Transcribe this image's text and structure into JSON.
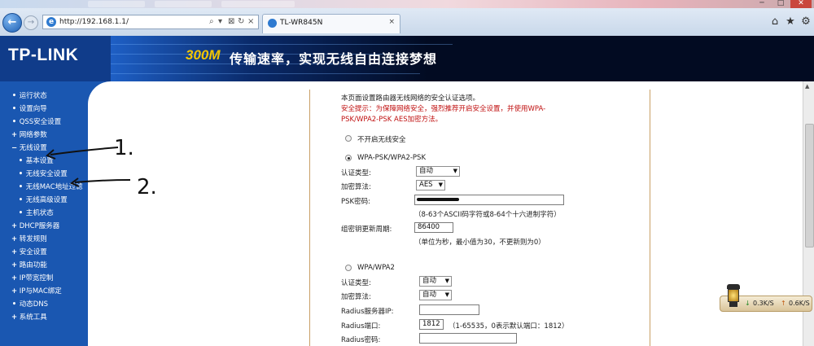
{
  "browser": {
    "address": "http://192.168.1.1/",
    "tab_title": "TL-WR845N",
    "tab_close": "×",
    "nav_back": "←",
    "nav_forward": "→",
    "address_tools": [
      "⌕",
      "▾",
      "⊠",
      "↻",
      "×"
    ],
    "window_buttons": [
      "─",
      "□",
      "✕"
    ],
    "right_tools": [
      "⌂",
      "★",
      "⚙"
    ]
  },
  "banner": {
    "logo": "TP-LINK",
    "slogan_highlight": "300M",
    "slogan": "传输速率，实现无线自由连接梦想"
  },
  "menu": {
    "items": [
      {
        "marker": "•",
        "label": "运行状态"
      },
      {
        "marker": "•",
        "label": "设置向导"
      },
      {
        "marker": "•",
        "label": "QSS安全设置"
      },
      {
        "marker": "+",
        "label": "网络参数"
      },
      {
        "marker": "−",
        "label": "无线设置"
      },
      {
        "marker": "•",
        "label": "基本设置",
        "sub": true
      },
      {
        "marker": "•",
        "label": "无线安全设置",
        "sub": true
      },
      {
        "marker": "•",
        "label": "无线MAC地址过滤",
        "sub": true
      },
      {
        "marker": "•",
        "label": "无线高级设置",
        "sub": true
      },
      {
        "marker": "•",
        "label": "主机状态",
        "sub": true
      },
      {
        "marker": "+",
        "label": "DHCP服务器"
      },
      {
        "marker": "+",
        "label": "转发规则"
      },
      {
        "marker": "+",
        "label": "安全设置"
      },
      {
        "marker": "+",
        "label": "路由功能"
      },
      {
        "marker": "+",
        "label": "IP带宽控制"
      },
      {
        "marker": "+",
        "label": "IP与MAC绑定"
      },
      {
        "marker": "•",
        "label": "动态DNS"
      },
      {
        "marker": "+",
        "label": "系统工具"
      }
    ]
  },
  "form": {
    "intro": "本页面设置路由器无线网络的安全认证选项。",
    "tip_line1": "安全提示：为保障网络安全，强烈推荐开启安全设置，并使用WPA-",
    "tip_line2": "PSK/WPA2-PSK AES加密方法。",
    "option_none": "不开启无线安全",
    "option_psk": "WPA-PSK/WPA2-PSK",
    "psk_auth_label": "认证类型:",
    "psk_auth_value": "自动",
    "psk_enc_label": "加密算法:",
    "psk_enc_value": "AES",
    "psk_key_label": "PSK密码:",
    "psk_key_hint": "（8-63个ASCII码字符或8-64个十六进制字符）",
    "rekey_label": "组密钥更新周期:",
    "rekey_value": "86400",
    "rekey_hint": "（单位为秒，最小值为30，不更新则为0）",
    "option_wpa": "WPA/WPA2",
    "wpa_auth_label": "认证类型:",
    "wpa_auth_value": "自动",
    "wpa_enc_label": "加密算法:",
    "wpa_enc_value": "自动",
    "radius_ip_label": "Radius服务器IP:",
    "radius_port_label": "Radius端口:",
    "radius_port_value": "1812",
    "radius_port_hint": "（1-65535，0表示默认端口：1812）",
    "radius_pw_label": "Radius密码:"
  },
  "speed": {
    "down": "0.3K/S",
    "up": "0.6K/S",
    "down_arrow": "↓",
    "up_arrow": "↑"
  },
  "annotations": {
    "label1": "1.",
    "label2": "2."
  },
  "colors": {
    "menu_bg": "#1a57b1",
    "banner_bg": "#05173f",
    "slogan_accent": "#f2c500",
    "warning_text": "#c01010"
  }
}
